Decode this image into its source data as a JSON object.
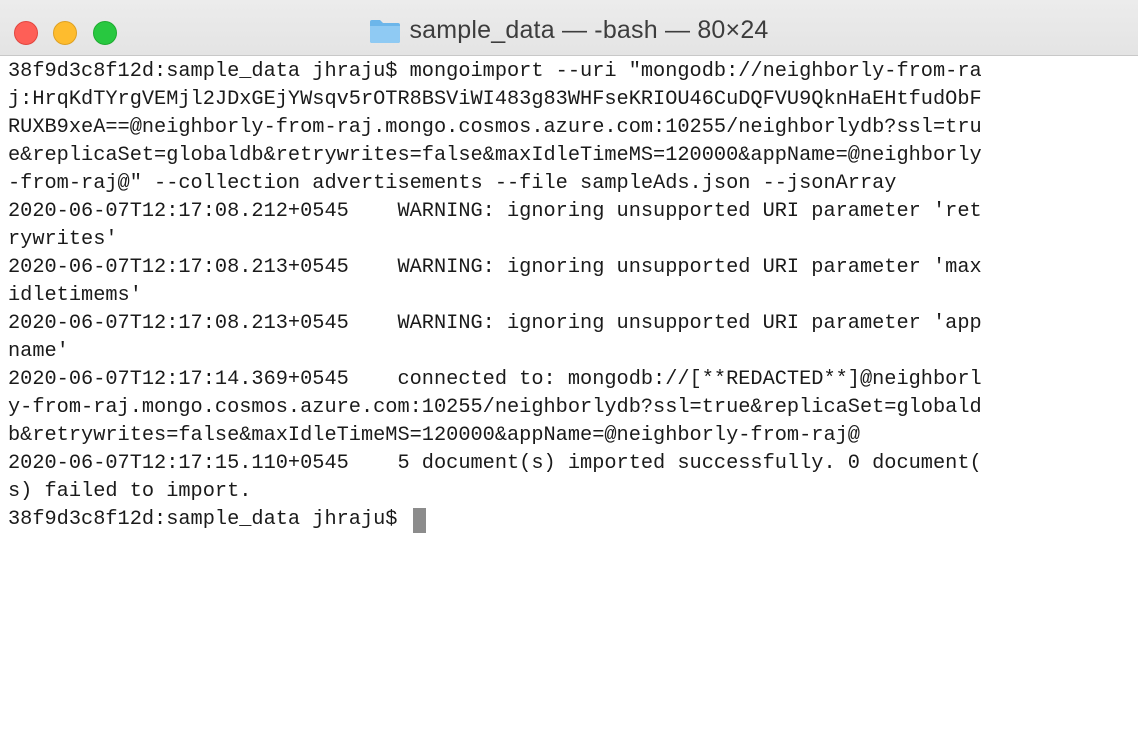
{
  "window": {
    "title": "sample_data — -bash — 80×24",
    "folder_icon": "folder-icon",
    "buttons": {
      "close_color": "#fe5f57",
      "minimize_color": "#febc2e",
      "zoom_color": "#28c840"
    }
  },
  "terminal": {
    "lines": [
      "38f9d3c8f12d:sample_data jhraju$ mongoimport --uri \"mongodb://neighborly-from-ra",
      "j:HrqKdTYrgVEMjl2JDxGEjYWsqv5rOTR8BSViWI483g83WHFseKRIOU46CuDQFVU9QknHaEHtfudObF",
      "RUXB9xeA==@neighborly-from-raj.mongo.cosmos.azure.com:10255/neighborlydb?ssl=tru",
      "e&replicaSet=globaldb&retrywrites=false&maxIdleTimeMS=120000&appName=@neighborly",
      "-from-raj@\" --collection advertisements --file sampleAds.json --jsonArray",
      "2020-06-07T12:17:08.212+0545    WARNING: ignoring unsupported URI parameter 'ret",
      "rywrites'",
      "2020-06-07T12:17:08.213+0545    WARNING: ignoring unsupported URI parameter 'max",
      "idletimems'",
      "2020-06-07T12:17:08.213+0545    WARNING: ignoring unsupported URI parameter 'app",
      "name'",
      "2020-06-07T12:17:14.369+0545    connected to: mongodb://[**REDACTED**]@neighborl",
      "y-from-raj.mongo.cosmos.azure.com:10255/neighborlydb?ssl=true&replicaSet=globald",
      "b&retrywrites=false&maxIdleTimeMS=120000&appName=@neighborly-from-raj@",
      "2020-06-07T12:17:15.110+0545    5 document(s) imported successfully. 0 document(",
      "s) failed to import."
    ],
    "prompt": "38f9d3c8f12d:sample_data jhraju$ "
  }
}
